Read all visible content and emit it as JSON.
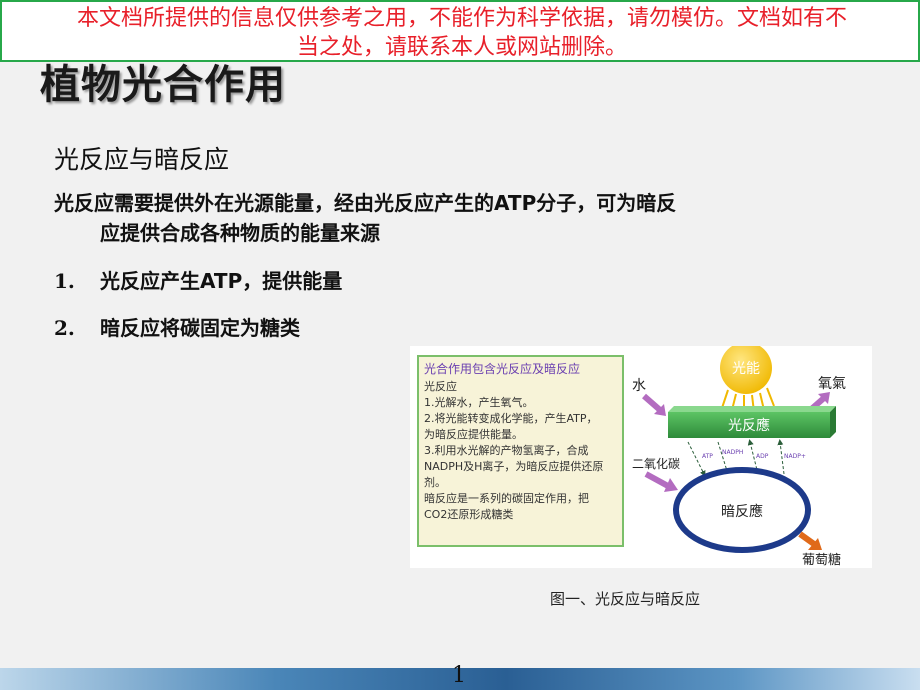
{
  "banner": {
    "line1": "本文档所提供的信息仅供参考之用，不能作为科学依据，请勿模仿。文档如有不",
    "line2": "当之处，请联系本人或网站删除。"
  },
  "title": "植物光合作用",
  "subtitle": "光反应与暗反应",
  "paragraph": {
    "line1": "光反应需要提供外在光源能量，经由光反应产生的ATP分子，可为暗反",
    "line2": "应提供合成各种物质的能量来源"
  },
  "list": [
    {
      "num": "1.",
      "text": "光反应产生ATP，提供能量"
    },
    {
      "num": "2.",
      "text": "暗反应将碳固定为糖类"
    }
  ],
  "figure": {
    "box_title": "光合作用包含光反应及暗反应",
    "box_lines": [
      "光反应",
      "1.光解水，产生氧气。",
      "2.将光能转变成化学能，产生ATP，",
      "为暗反应提供能量。",
      "3.利用水光解的产物氢离子，合成",
      "NADPH及H离子，为暗反应提供还原",
      "剂。",
      "暗反应是一系列的碳固定作用，把",
      "CO2还原形成糖类"
    ],
    "sun_label": "光能",
    "water_label": "水",
    "oxygen_label": "氧氣",
    "light_reaction_label": "光反應",
    "co2_label": "二氧化碳",
    "dark_reaction_label": "暗反應",
    "glucose_label": "葡萄糖",
    "arrow_labels": [
      "ATP",
      "NADPH",
      "ADP",
      "NADP+"
    ]
  },
  "caption": "图一、光反应与暗反应",
  "page_number": "1",
  "colors": {
    "banner_text": "#e8202a",
    "banner_border": "#27a84a",
    "light_box": "#3ea84a",
    "sun": "#f2c200",
    "arrow_pink": "#b36cc0",
    "arrow_orange": "#e06a1a",
    "dark_ring": "#1d3a8a"
  }
}
